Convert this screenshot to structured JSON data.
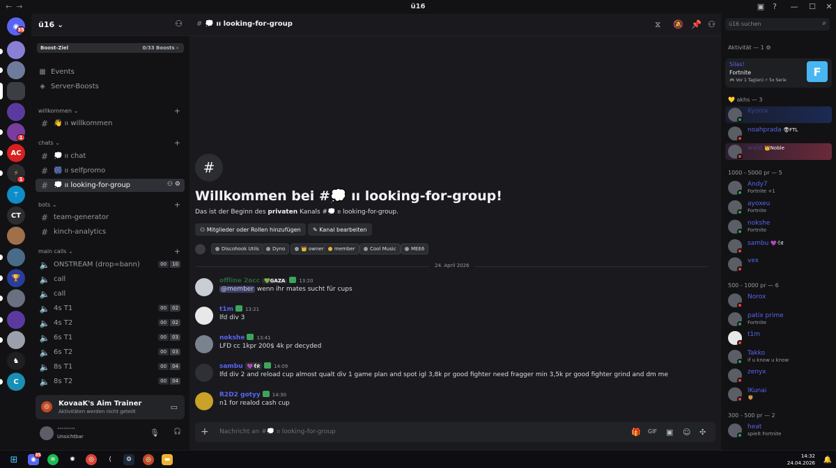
{
  "window": {
    "title": "ü16",
    "back": "←",
    "forward": "→"
  },
  "server": {
    "name": "ü16 ⌄",
    "boost_label": "Boost-Ziel",
    "boost_count": "0/33 Boosts ›"
  },
  "sidebar": {
    "top_items": [
      {
        "icon": "calendar-icon",
        "label": "Events"
      },
      {
        "icon": "boost-icon",
        "label": "Server-Boosts"
      }
    ],
    "categories": [
      {
        "name": "willkommen ⌄",
        "channels": [
          {
            "label": "👋 ıı willkommen"
          }
        ]
      },
      {
        "name": "chats ⌄",
        "channels": [
          {
            "label": "💭 ıı chat"
          },
          {
            "label": "🎆 ıı selfpromo"
          },
          {
            "label": "💭 ıı looking-for-group",
            "active": true
          }
        ]
      },
      {
        "name": "bots ⌄",
        "channels": [
          {
            "label": "team-generator"
          },
          {
            "label": "kinch-analytics"
          }
        ]
      },
      {
        "name": "main calls ⌄",
        "channels": [
          {
            "label": "ONSTREAM (drop=bann)",
            "c1": "00",
            "c2": "10"
          },
          {
            "label": "call"
          },
          {
            "label": "call"
          },
          {
            "label": "4s T1",
            "c1": "00",
            "c2": "02"
          },
          {
            "label": "4s T2",
            "c1": "00",
            "c2": "02"
          },
          {
            "label": "6s T1",
            "c1": "00",
            "c2": "03"
          },
          {
            "label": "6s T2",
            "c1": "00",
            "c2": "03"
          },
          {
            "label": "8s T1",
            "c1": "00",
            "c2": "04"
          },
          {
            "label": "8s T2",
            "c1": "00",
            "c2": "04"
          }
        ]
      }
    ]
  },
  "activity": {
    "title": "KovaaK's Aim Trainer",
    "subtitle": "Aktivitäten werden nicht geteilt"
  },
  "user": {
    "name": "·········",
    "status": "Unsichtbar"
  },
  "guild_badges": {
    "home": "35",
    "g6": "1",
    "g9": "1",
    "ct": "CT"
  },
  "chat": {
    "header": "💭 ıı looking-for-group",
    "welcome_title": "Willkommen bei #💭 ıı looking-for-group!",
    "welcome_sub_1": "Das ist der Beginn des ",
    "welcome_sub_bold": "privaten",
    "welcome_sub_2": " Kanals #💭 ıı looking-for-group.",
    "btn_add": "⚇ Mitglieder oder Rollen hinzufügen",
    "btn_edit": "✎ Kanal bearbeiten",
    "roles": [
      "Discohook Utils",
      "Dyno",
      "👑 owner",
      "member",
      "Cool Music",
      "MEE6"
    ],
    "date": "24. April 2026",
    "messages": [
      {
        "author": "offline 2acc",
        "badge": "💚GAZA",
        "time": "13:20",
        "mention": "@member",
        "text": " wenn ihr mates sucht für cups",
        "color": "#3ba55c"
      },
      {
        "author": "t1m",
        "badge": "",
        "time": "13:21",
        "text": "lfd div 3",
        "color": "#5865f2"
      },
      {
        "author": "nokshe",
        "badge": "",
        "time": "13:41",
        "text": "LFD cc 1kpr 200$ 4k pr decyded",
        "color": "#5865f2"
      },
      {
        "author": "sambu",
        "badge": "💜ꑀᖇ",
        "time": "14:09",
        "text": "lfd div 2 and reload cup almost qualt div 1 game plan and spot igl 3,8k pr good fighter need fragger min 3,5k pr good fighter grind and dm me",
        "color": "#5865f2"
      },
      {
        "author": "R2D2 gotyy",
        "badge": "",
        "time": "14:30",
        "text": "n1 for realod cash cup",
        "color": "#5865f2"
      }
    ],
    "composer_placeholder": "Nachricht an #💭 ıı looking-for-group"
  },
  "members": {
    "search_placeholder": "ü16 suchen",
    "activity_header": "Aktivität — 1 ⚙",
    "activity_card": {
      "name": "Silas!",
      "game": "Fortnite",
      "meta": "🎮 Vor 1 Tag(en)  ⚡ 5x Serie"
    },
    "groups": [
      {
        "title": "💛 akhs — 3",
        "members": [
          {
            "name": "Kyonix",
            "sub": "",
            "color": "#5865f2",
            "status": "#23a55a"
          },
          {
            "name": "noahprada",
            "tag": "👽FTL",
            "sub": "",
            "color": "#5865f2",
            "status": "#f23f43"
          },
          {
            "name": "wald",
            "tag": "👑Noble",
            "sub": "",
            "color": "#5865f2",
            "status": "#f23f43"
          }
        ]
      },
      {
        "title": "1000 - 5000 pr — 5",
        "members": [
          {
            "name": "Andy7",
            "sub": "Fortnite +1",
            "color": "#5865f2",
            "status": "#23a55a"
          },
          {
            "name": "ayoxeu",
            "sub": "Fortnite",
            "color": "#5865f2",
            "status": "#23a55a"
          },
          {
            "name": "nokshe",
            "sub": "Fortnite",
            "color": "#5865f2",
            "status": "#23a55a"
          },
          {
            "name": "sambu",
            "tag": "💜ꑀᖇ",
            "sub": "",
            "color": "#5865f2",
            "status": "#f23f43"
          },
          {
            "name": "vex",
            "sub": "",
            "color": "#5865f2",
            "status": "#f23f43"
          }
        ]
      },
      {
        "title": "500 - 1000 pr — 6",
        "members": [
          {
            "name": "Norox",
            "sub": "",
            "color": "#5865f2",
            "status": "#f23f43"
          },
          {
            "name": "patix prime",
            "sub": "Fortnite",
            "color": "#5865f2",
            "status": "#23a55a"
          },
          {
            "name": "t1m",
            "sub": "",
            "color": "#5865f2",
            "status": "#f23f43"
          },
          {
            "name": "Takko",
            "sub": "if u know u know",
            "color": "#5865f2",
            "status": "#23a55a"
          },
          {
            "name": "zenyx",
            "sub": "",
            "color": "#5865f2",
            "status": "#f23f43"
          },
          {
            "name": "lKunai",
            "sub": "🦁",
            "color": "#5865f2",
            "status": "#f23f43"
          }
        ]
      },
      {
        "title": "300 - 500 pr — 2",
        "members": [
          {
            "name": "heat",
            "sub": "spielt Fortnite",
            "color": "#5865f2",
            "status": "#23a55a"
          }
        ]
      }
    ]
  },
  "taskbar": {
    "time": "14:32",
    "date": "24.04.2026",
    "discord_badge": "35"
  }
}
